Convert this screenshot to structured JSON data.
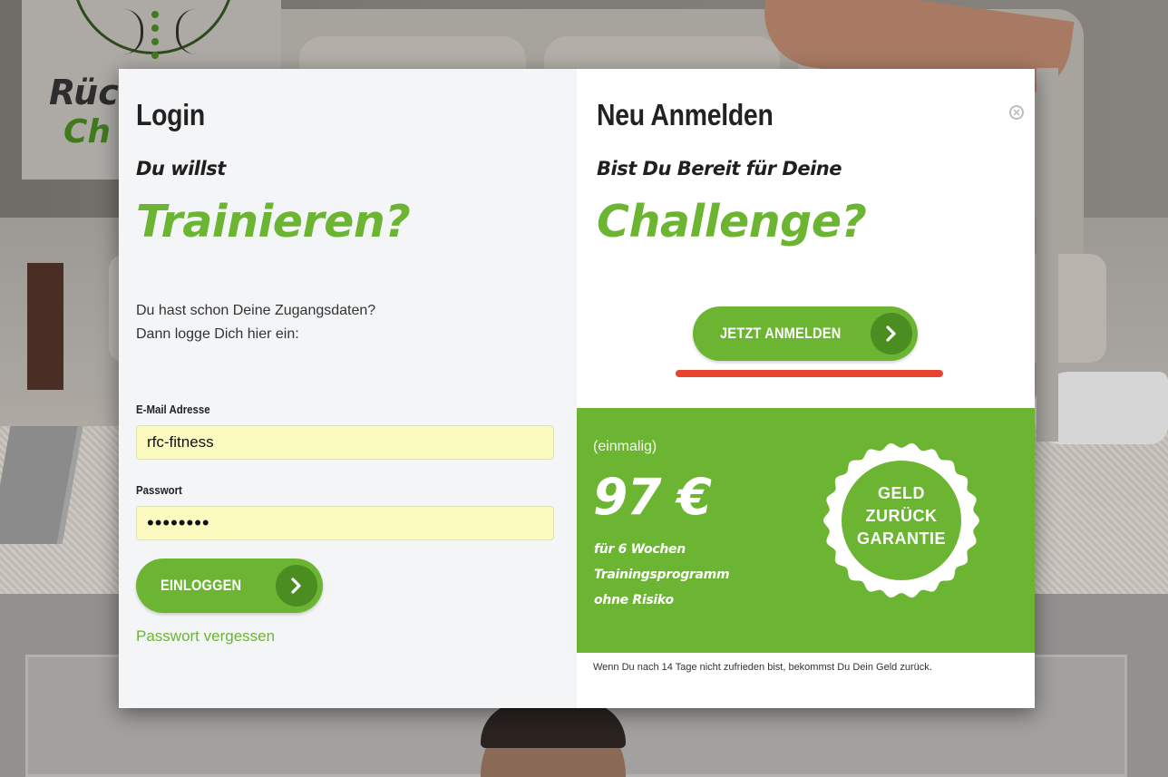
{
  "background": {
    "logo_line1": "Rüc",
    "logo_line2": "Ch"
  },
  "login": {
    "title": "Login",
    "subtitle": "Du willst",
    "headline": "Trainieren?",
    "intro_line1": "Du hast schon Deine Zugangsdaten?",
    "intro_line2": "Dann logge Dich hier ein:",
    "email_label": "E-Mail Adresse",
    "email_value": "rfc-fitness",
    "password_label": "Passwort",
    "password_value": "••••••••",
    "submit_label": "EINLOGGEN",
    "forgot_label": "Passwort vergessen"
  },
  "register": {
    "title": "Neu Anmelden",
    "subtitle": "Bist Du Bereit für Deine",
    "headline": "Challenge?",
    "cta_label": "JETZT ANMELDEN",
    "price_note": "(einmalig)",
    "price": "97 €",
    "desc_line1": "für 6 Wochen",
    "desc_line2": "Trainingsprogramm",
    "desc_line3": "ohne Risiko",
    "seal_line1": "GELD",
    "seal_line2": "ZURÜCK",
    "seal_line3": "GARANTIE",
    "fineprint": "Wenn Du nach 14 Tage nicht zufrieden bist, bekommst Du Dein Geld zurück."
  },
  "colors": {
    "accent_green": "#6cb532",
    "dark_green": "#4a8e22",
    "highlight_red": "#e6442e",
    "input_yellow": "#fbfbc0"
  },
  "icons": [
    "chevron-right-icon",
    "close-icon",
    "badge-seal-icon"
  ]
}
